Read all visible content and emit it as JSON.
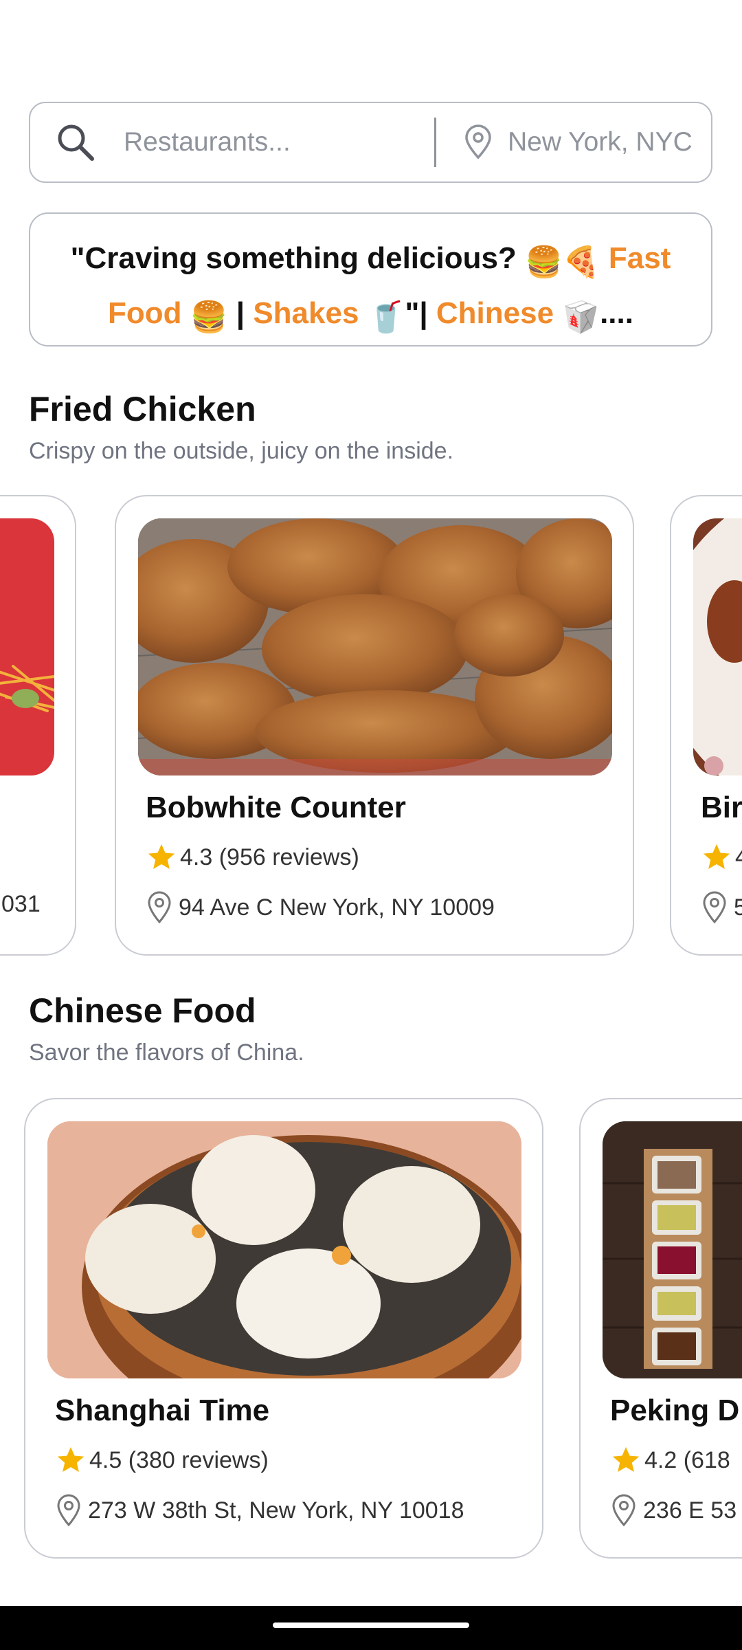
{
  "search": {
    "query_placeholder": "Restaurants...",
    "location_value": "New York, NYC"
  },
  "promo": {
    "part1": "\"Craving something delicious? ",
    "emoji1": "🍔🍕",
    "fast_food": "Fast Food",
    "emoji2": "🍔",
    "sep1": " | ",
    "shakes": "Shakes",
    "emoji3": "🥤",
    "sep2": "\"| ",
    "chinese": "Chinese",
    "emoji4": "🥡",
    "ellipsis": "...."
  },
  "sections": [
    {
      "title": "Fried Chicken",
      "subtitle": "Crispy on the outside, juicy on the inside.",
      "cards": [
        {
          "name": "",
          "rating": "",
          "address": "031"
        },
        {
          "name": "Bobwhite Counter",
          "rating": "4.3 (956 reviews)",
          "address": "94 Ave C New York, NY 10009"
        },
        {
          "name": "Bir",
          "rating": "4",
          "address": "5"
        }
      ]
    },
    {
      "title": "Chinese Food",
      "subtitle": "Savor the flavors of China.",
      "cards": [
        {
          "name": "Shanghai Time",
          "rating": "4.5 (380 reviews)",
          "address": "273 W 38th St, New York, NY 10018"
        },
        {
          "name": "Peking D",
          "rating": "4.2 (618",
          "address": "236 E 53"
        }
      ]
    }
  ],
  "colors": {
    "accent": "#f08a2a",
    "star": "#f6b400",
    "border": "#c9ccd3"
  },
  "icons": [
    "search-icon",
    "location-pin-icon",
    "star-icon"
  ]
}
